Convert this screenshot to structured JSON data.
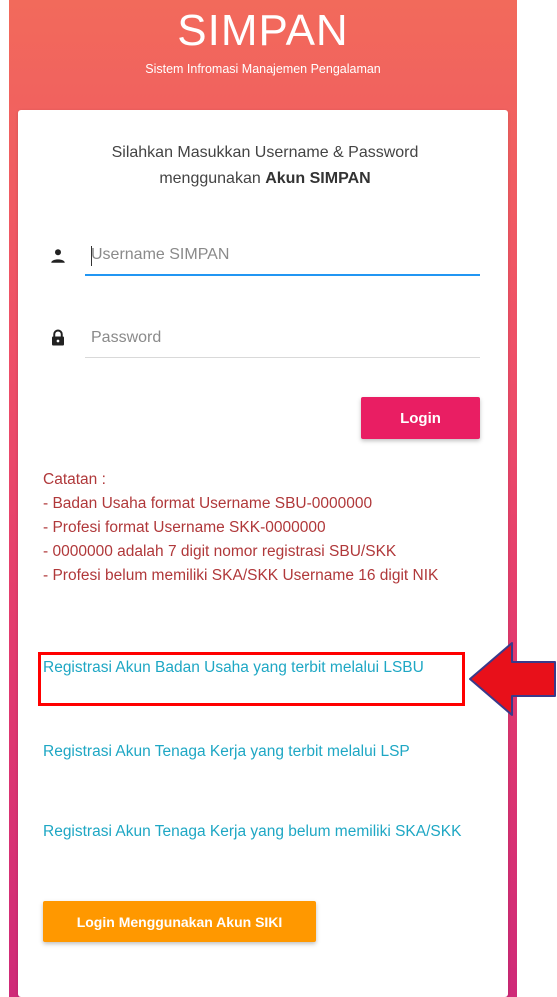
{
  "header": {
    "title": "SIMPAN",
    "subtitle": "Sistem Infromasi Manajemen Pengalaman"
  },
  "intro": {
    "line1": "Silahkan Masukkan Username & Password",
    "line2_prefix": "menggunakan ",
    "line2_bold": "Akun SIMPAN"
  },
  "form": {
    "username_placeholder": "Username SIMPAN",
    "username_icon": "person-icon",
    "password_placeholder": "Password",
    "password_icon": "lock-icon",
    "login_label": "Login"
  },
  "notes": {
    "heading": "Catatan :",
    "lines": [
      "- Badan Usaha format Username SBU-0000000",
      "- Profesi format Username SKK-0000000",
      "- 0000000 adalah 7 digit nomor registrasi SBU/SKK",
      "- Profesi belum memiliki SKA/SKK Username 16 digit NIK"
    ]
  },
  "links": [
    "Registrasi Akun Badan Usaha yang terbit melalui LSBU",
    "Registrasi Akun Tenaga Kerja yang terbit melalui LSP",
    "Registrasi Akun Tenaga Kerja yang belum memiliki SKA/SKK"
  ],
  "siki_button_label": "Login Menggunakan Akun SIKI",
  "colors": {
    "header_gradient_top": "#f26a5b",
    "header_gradient_bottom": "#cf2a78",
    "login_button": "#e91e63",
    "siki_button": "#ff9800",
    "link": "#1ea7c4",
    "note_text": "#b0383a",
    "highlight": "#ff0000"
  }
}
